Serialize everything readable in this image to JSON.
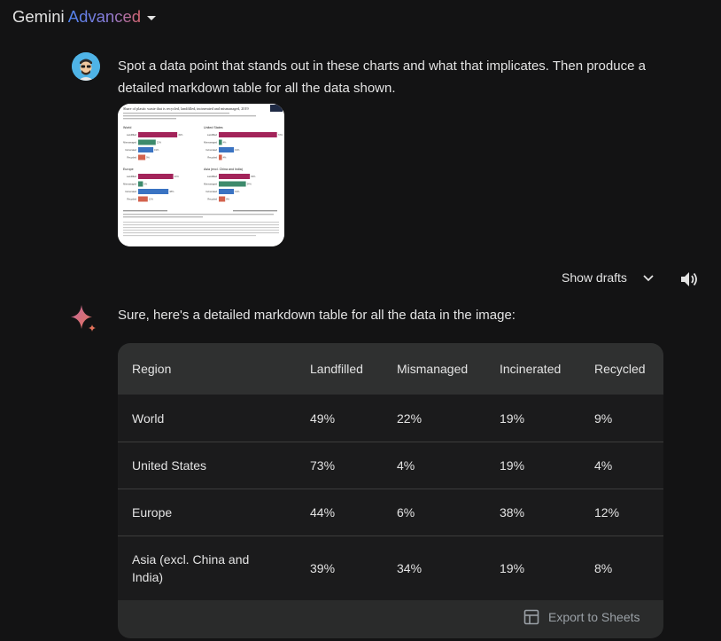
{
  "header": {
    "brand": "Gemini",
    "brand_accent": "Advanced"
  },
  "user": {
    "prompt": "Spot a data point that stands out in these charts and what that implicates. Then produce a detailed markdown table for all the data shown."
  },
  "attachment": {
    "title": "Share of plastic waste that is recycled, landfilled, incinerated and mismanaged, 2019",
    "panels": [
      {
        "label": "World",
        "values": [
          49,
          22,
          19,
          9
        ]
      },
      {
        "label": "United States",
        "values": [
          73,
          4,
          19,
          4
        ]
      },
      {
        "label": "Europe",
        "values": [
          44,
          6,
          38,
          12
        ]
      },
      {
        "label": "Asia (excl. China and India)",
        "values": [
          39,
          34,
          19,
          8
        ]
      }
    ],
    "categories": [
      "Landfilled",
      "Mismanaged",
      "Incinerated",
      "Recycled"
    ],
    "colors": [
      "#a3245a",
      "#3d8a6c",
      "#3a73c2",
      "#d3624d"
    ]
  },
  "actions": {
    "show_drafts": "Show drafts"
  },
  "response": {
    "intro": "Sure, here's a detailed markdown table for all the data in the image:",
    "table": {
      "headers": [
        "Region",
        "Landfilled",
        "Mismanaged",
        "Incinerated",
        "Recycled"
      ],
      "rows": [
        [
          "World",
          "49%",
          "22%",
          "19%",
          "9%"
        ],
        [
          "United States",
          "73%",
          "4%",
          "19%",
          "4%"
        ],
        [
          "Europe",
          "44%",
          "6%",
          "38%",
          "12%"
        ],
        [
          "Asia (excl. China and India)",
          "39%",
          "34%",
          "19%",
          "8%"
        ]
      ]
    },
    "export_label": "Export to Sheets"
  }
}
